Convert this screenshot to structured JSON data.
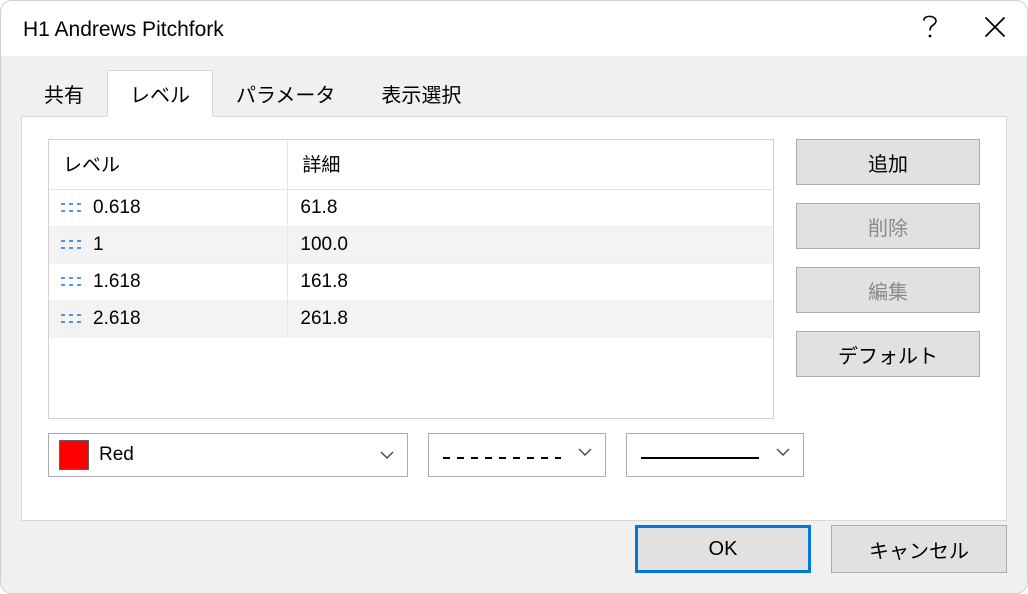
{
  "window": {
    "title": "H1 Andrews Pitchfork"
  },
  "tabs": {
    "share": "共有",
    "levels": "レベル",
    "parameters": "パラメータ",
    "display": "表示選択"
  },
  "table": {
    "headers": {
      "level": "レベル",
      "detail": "詳細"
    },
    "rows": [
      {
        "level": "0.618",
        "detail": "61.8"
      },
      {
        "level": "1",
        "detail": "100.0"
      },
      {
        "level": "1.618",
        "detail": "161.8"
      },
      {
        "level": "2.618",
        "detail": "261.8"
      }
    ]
  },
  "sideButtons": {
    "add": "追加",
    "delete": "削除",
    "edit": "編集",
    "defaults": "デフォルト"
  },
  "colorSelector": {
    "label": "Red",
    "hex": "#ff0000"
  },
  "dialogButtons": {
    "ok": "OK",
    "cancel": "キャンセル"
  }
}
